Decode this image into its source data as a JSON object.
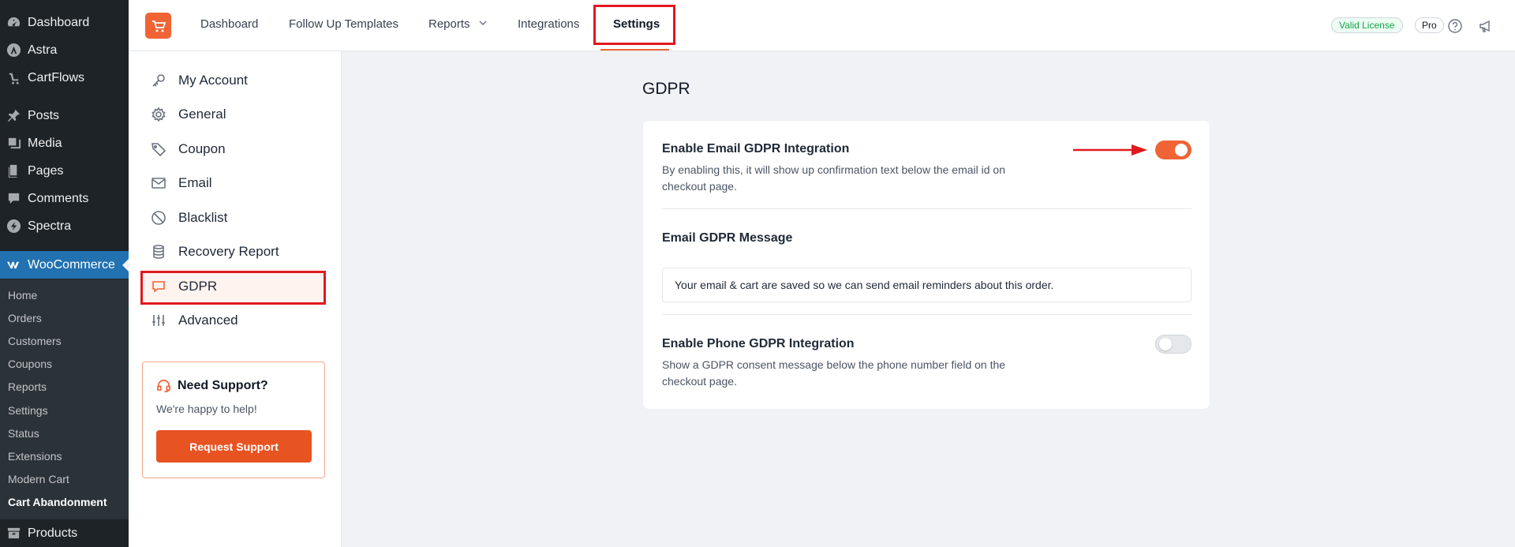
{
  "wp_menu": {
    "items": [
      {
        "label": "Dashboard",
        "icon": "dashboard-icon"
      },
      {
        "label": "Astra",
        "icon": "astra-icon"
      },
      {
        "label": "CartFlows",
        "icon": "cartflows-icon"
      },
      {
        "label": "Posts",
        "icon": "pin-icon"
      },
      {
        "label": "Media",
        "icon": "media-icon"
      },
      {
        "label": "Pages",
        "icon": "pages-icon"
      },
      {
        "label": "Comments",
        "icon": "comment-icon"
      },
      {
        "label": "Spectra",
        "icon": "spectra-icon"
      },
      {
        "label": "WooCommerce",
        "icon": "woo-icon"
      },
      {
        "label": "Products",
        "icon": "archive-icon"
      }
    ],
    "submenu": [
      "Home",
      "Orders",
      "Customers",
      "Coupons",
      "Reports",
      "Settings",
      "Status",
      "Extensions",
      "Modern Cart",
      "Cart Abandonment"
    ]
  },
  "topnav": {
    "tabs": [
      "Dashboard",
      "Follow Up Templates",
      "Reports",
      "Integrations",
      "Settings"
    ],
    "active_tab": "Settings",
    "license_badge": "Valid License",
    "plan_badge": "Pro"
  },
  "settings_nav": {
    "items": [
      {
        "label": "My Account",
        "icon": "key-icon"
      },
      {
        "label": "General",
        "icon": "gear-icon"
      },
      {
        "label": "Coupon",
        "icon": "tag-icon"
      },
      {
        "label": "Email",
        "icon": "mail-icon"
      },
      {
        "label": "Blacklist",
        "icon": "ban-icon"
      },
      {
        "label": "Recovery Report",
        "icon": "database-icon"
      },
      {
        "label": "GDPR",
        "icon": "chat-bubble-icon"
      },
      {
        "label": "Advanced",
        "icon": "sliders-icon"
      }
    ],
    "active": "GDPR"
  },
  "support": {
    "title": "Need Support?",
    "subtitle": "We're happy to help!",
    "button": "Request Support"
  },
  "main": {
    "title": "GDPR",
    "email_gdpr": {
      "title": "Enable Email GDPR Integration",
      "description": "By enabling this, it will show up confirmation text below the email id on checkout page.",
      "enabled": true
    },
    "email_message": {
      "title": "Email GDPR Message",
      "value": "Your email & cart are saved so we can send email reminders about this order."
    },
    "phone_gdpr": {
      "title": "Enable Phone GDPR Integration",
      "description": "Show a GDPR consent message below the phone number field on the checkout page.",
      "enabled": false
    }
  },
  "colors": {
    "accent": "#f06335",
    "highlight": "#e0191f",
    "wp_sidebar": "#1d2327",
    "wp_active": "#2271b1"
  }
}
